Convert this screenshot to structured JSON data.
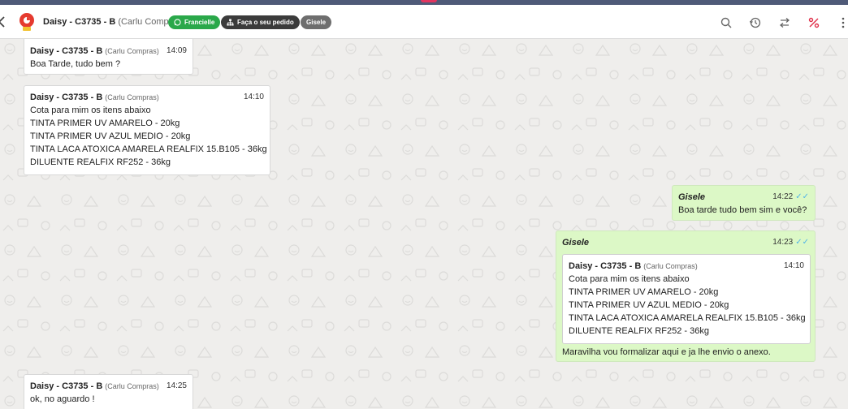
{
  "header": {
    "contact_name": "Daisy - C3735 - B",
    "contact_sub": "(Carlu Compras)",
    "tags": [
      "Francielle",
      "Faça o seu pedido",
      "Gisele"
    ]
  },
  "colors": {
    "accent_green": "#2aa84a",
    "outgoing_bubble": "#dcf8c6",
    "read_ticks": "#4fb3e8"
  },
  "messages": [
    {
      "sender": "Daisy - C3735 - B",
      "sender_sub": "(Carlu Compras)",
      "time": "14:09",
      "text": "Boa Tarde, tudo bem ?"
    },
    {
      "sender": "Daisy - C3735 - B",
      "sender_sub": "(Carlu Compras)",
      "time": "14:10",
      "lines": [
        "Cota para mim os itens abaixo",
        "TINTA PRIMER UV AMARELO - 20kg",
        "TINTA PRIMER UV AZUL MEDIO - 20kg",
        "TINTA LACA ATOXICA AMARELA REALFIX 15.B105 - 36kg",
        "DILUENTE REALFIX RF252 - 36kg"
      ]
    },
    {
      "sender": "Gisele",
      "time": "14:22",
      "text": "Boa tarde tudo bem sim e você?"
    },
    {
      "sender": "Gisele",
      "time": "14:23",
      "quoted": {
        "sender": "Daisy - C3735 - B",
        "sender_sub": "(Carlu Compras)",
        "time": "14:10",
        "lines": [
          "Cota para mim os itens abaixo",
          "TINTA PRIMER UV AMARELO - 20kg",
          "TINTA PRIMER UV AZUL MEDIO - 20kg",
          "TINTA LACA ATOXICA AMARELA REALFIX 15.B105 - 36kg",
          "DILUENTE REALFIX RF252 - 36kg"
        ]
      },
      "text": "Maravilha vou formalizar aqui e ja lhe envio o anexo."
    },
    {
      "sender": "Daisy - C3735 - B",
      "sender_sub": "(Carlu Compras)",
      "time": "14:25",
      "text": "ok, no aguardo !"
    }
  ]
}
